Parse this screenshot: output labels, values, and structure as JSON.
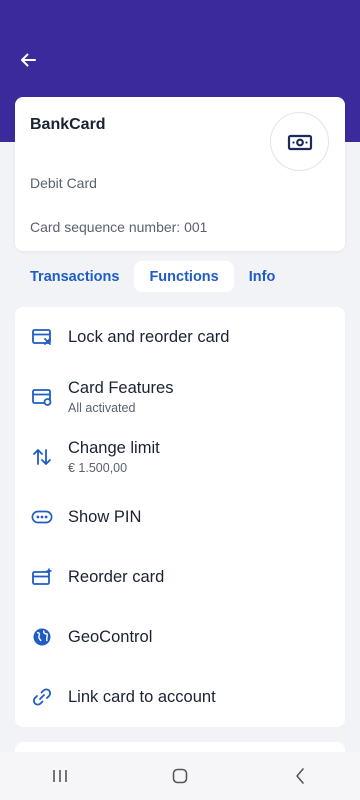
{
  "header": {
    "back_icon": "arrow-left-icon",
    "band_color": "#3a2a9c"
  },
  "card": {
    "title": "BankCard",
    "type": "Debit Card",
    "sequence": "Card sequence number: 001",
    "badge_icon": "banknote-icon"
  },
  "tabs": [
    {
      "label": "Transactions",
      "active": false
    },
    {
      "label": "Functions",
      "active": true
    },
    {
      "label": "Info",
      "active": false
    }
  ],
  "functions": [
    {
      "label": "Lock and reorder card",
      "sub": "",
      "icon": "card-lock-icon"
    },
    {
      "label": "Card Features",
      "sub": "All activated",
      "icon": "card-settings-icon"
    },
    {
      "label": "Change limit",
      "sub": "€ 1.500,00",
      "icon": "arrows-up-down-icon"
    },
    {
      "label": "Show PIN",
      "sub": "",
      "icon": "pin-dots-icon"
    },
    {
      "label": "Reorder card",
      "sub": "",
      "icon": "card-sparkle-icon"
    },
    {
      "label": "GeoControl",
      "sub": "",
      "icon": "globe-icon"
    },
    {
      "label": "Link card to account",
      "sub": "",
      "icon": "link-icon"
    }
  ],
  "system_nav": {
    "recent_icon": "recent-apps-icon",
    "home_icon": "home-icon",
    "back_icon": "system-back-icon"
  },
  "colors": {
    "accent": "#1f5cc4",
    "primary": "#3a2a9c",
    "text": "#1a2233",
    "muted": "#5a6170"
  }
}
